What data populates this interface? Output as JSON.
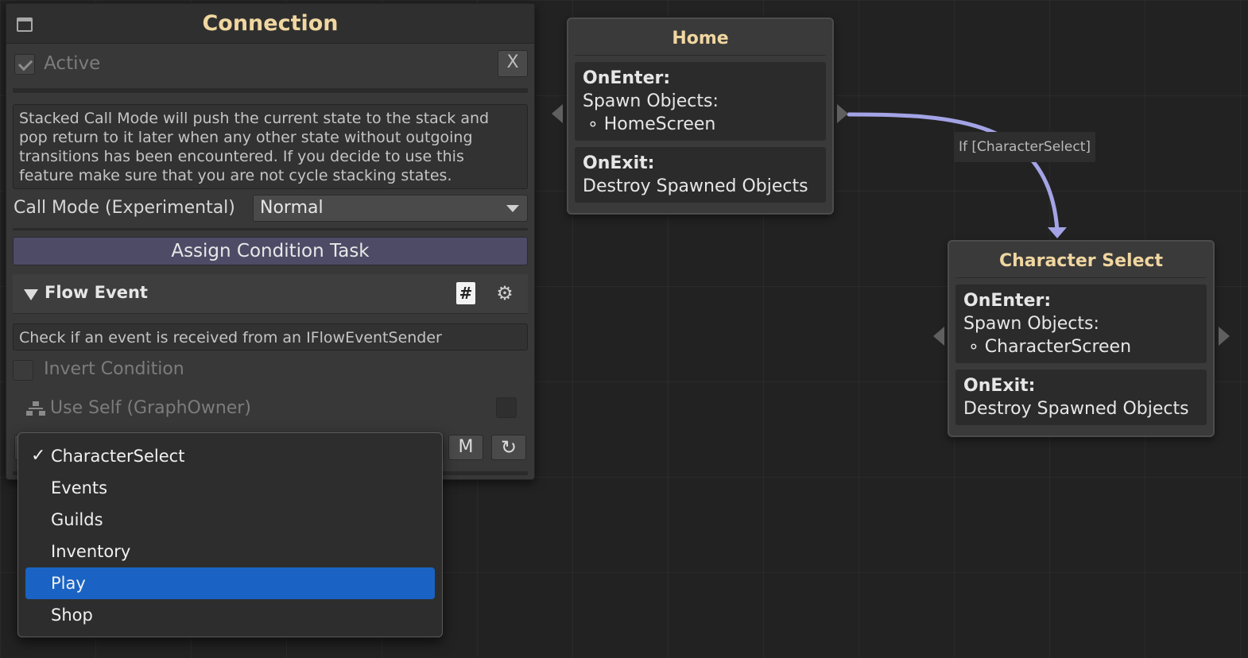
{
  "panel": {
    "title": "Connection",
    "active_label": "Active",
    "active_checked": true,
    "close_label": "X",
    "description": "Stacked Call Mode will push the current state to the stack and pop return to it later when any other state without outgoing transitions has been encountered. If you decide to use this feature make sure that you are not cycle stacking states.",
    "call_mode_label": "Call Mode (Experimental)",
    "call_mode_value": "Normal",
    "assign_button": "Assign Condition Task",
    "flow_event_label": "Flow Event",
    "hash_icon_glyph": "#",
    "flow_event_description": "Check if an event is received from an IFlowEventSender",
    "invert_label": "Invert Condition",
    "invert_checked": false,
    "use_self_label": "Use Self (GraphOwner)",
    "m_button": "M",
    "refresh_glyph": "↻",
    "gear_glyph": "⚙",
    "icons": [
      "minimize-icon",
      "checkbox-icon",
      "close-icon",
      "dropdown-caret-icon",
      "collapse-triangle-icon",
      "hash-script-icon",
      "gear-icon",
      "hierarchy-icon",
      "refresh-icon"
    ]
  },
  "popup": {
    "items": [
      {
        "label": "CharacterSelect",
        "checked": true,
        "highlighted": false
      },
      {
        "label": "Events",
        "checked": false,
        "highlighted": false
      },
      {
        "label": "Guilds",
        "checked": false,
        "highlighted": false
      },
      {
        "label": "Inventory",
        "checked": false,
        "highlighted": false
      },
      {
        "label": "Play",
        "checked": false,
        "highlighted": true
      },
      {
        "label": "Shop",
        "checked": false,
        "highlighted": false
      }
    ],
    "check_glyph": "✓",
    "highlight_color": "#1a63c4"
  },
  "nodes": {
    "home": {
      "title": "Home",
      "on_enter_label": "OnEnter:",
      "spawn_label": "Spawn Objects:",
      "spawn_item": "∘ HomeScreen",
      "on_exit_label": "OnExit:",
      "exit_action": "Destroy Spawned Objects"
    },
    "character_select": {
      "title": "Character Select",
      "on_enter_label": "OnEnter:",
      "spawn_label": "Spawn Objects:",
      "spawn_item": "∘ CharacterScreen",
      "on_exit_label": "OnExit:",
      "exit_action": "Destroy Spawned Objects"
    }
  },
  "wire": {
    "label": "If [CharacterSelect]",
    "color": "#a3a3e6"
  },
  "colors": {
    "title_accent": "#f0d6a0",
    "canvas_bg": "#222222",
    "assign_button_bg": "#4e4b66"
  }
}
